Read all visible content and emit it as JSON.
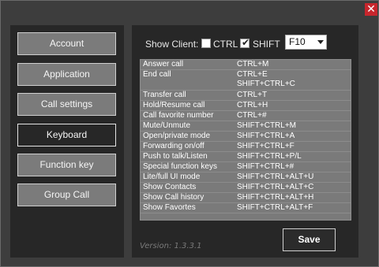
{
  "window": {
    "close_glyph": "✕"
  },
  "sidebar": {
    "items": [
      {
        "label": "Account",
        "active": false
      },
      {
        "label": "Application",
        "active": false
      },
      {
        "label": "Call settings",
        "active": false
      },
      {
        "label": "Keyboard",
        "active": true
      },
      {
        "label": "Function key",
        "active": false
      },
      {
        "label": "Group Call",
        "active": false
      }
    ]
  },
  "keyboard": {
    "show_client_label": "Show Client:",
    "ctrl": {
      "label": "CTRL",
      "checked": false
    },
    "shift": {
      "label": "SHIFT",
      "checked": true
    },
    "key_select": {
      "value": "F10"
    },
    "shortcuts": [
      {
        "action": "Answer call",
        "keys": "CTRL+M"
      },
      {
        "action": "End call",
        "keys": "CTRL+E\nSHIFT+CTRL+C"
      },
      {
        "action": "Transfer call",
        "keys": "CTRL+T"
      },
      {
        "action": "Hold/Resume call",
        "keys": "CTRL+H"
      },
      {
        "action": "Call favorite number",
        "keys": "CTRL+#"
      },
      {
        "action": "Mute/Unmute",
        "keys": "SHIFT+CTRL+M"
      },
      {
        "action": "Open/private mode",
        "keys": "SHIFT+CTRL+A"
      },
      {
        "action": "Forwarding on/off",
        "keys": "SHIFT+CTRL+F"
      },
      {
        "action": "Push to talk/Listen",
        "keys": "SHIFT+CTRL+P/L"
      },
      {
        "action": "Special function keys",
        "keys": "SHIFT+CTRL+#"
      },
      {
        "action": "Lite/full UI mode",
        "keys": "SHIFT+CTRL+ALT+U"
      },
      {
        "action": "Show Contacts",
        "keys": "SHIFT+CTRL+ALT+C"
      },
      {
        "action": "Show Call history",
        "keys": "SHIFT+CTRL+ALT+H"
      },
      {
        "action": "Show Favortes",
        "keys": "SHIFT+CTRL+ALT+F"
      }
    ],
    "version": "Version: 1.3.3.1",
    "save_label": "Save"
  },
  "colors": {
    "window_bg": "#3d3d3d",
    "panel_bg": "#272727",
    "button_bg": "#7b7b7b",
    "table_bg": "#7a7a7a",
    "close_red": "#c8262d"
  }
}
